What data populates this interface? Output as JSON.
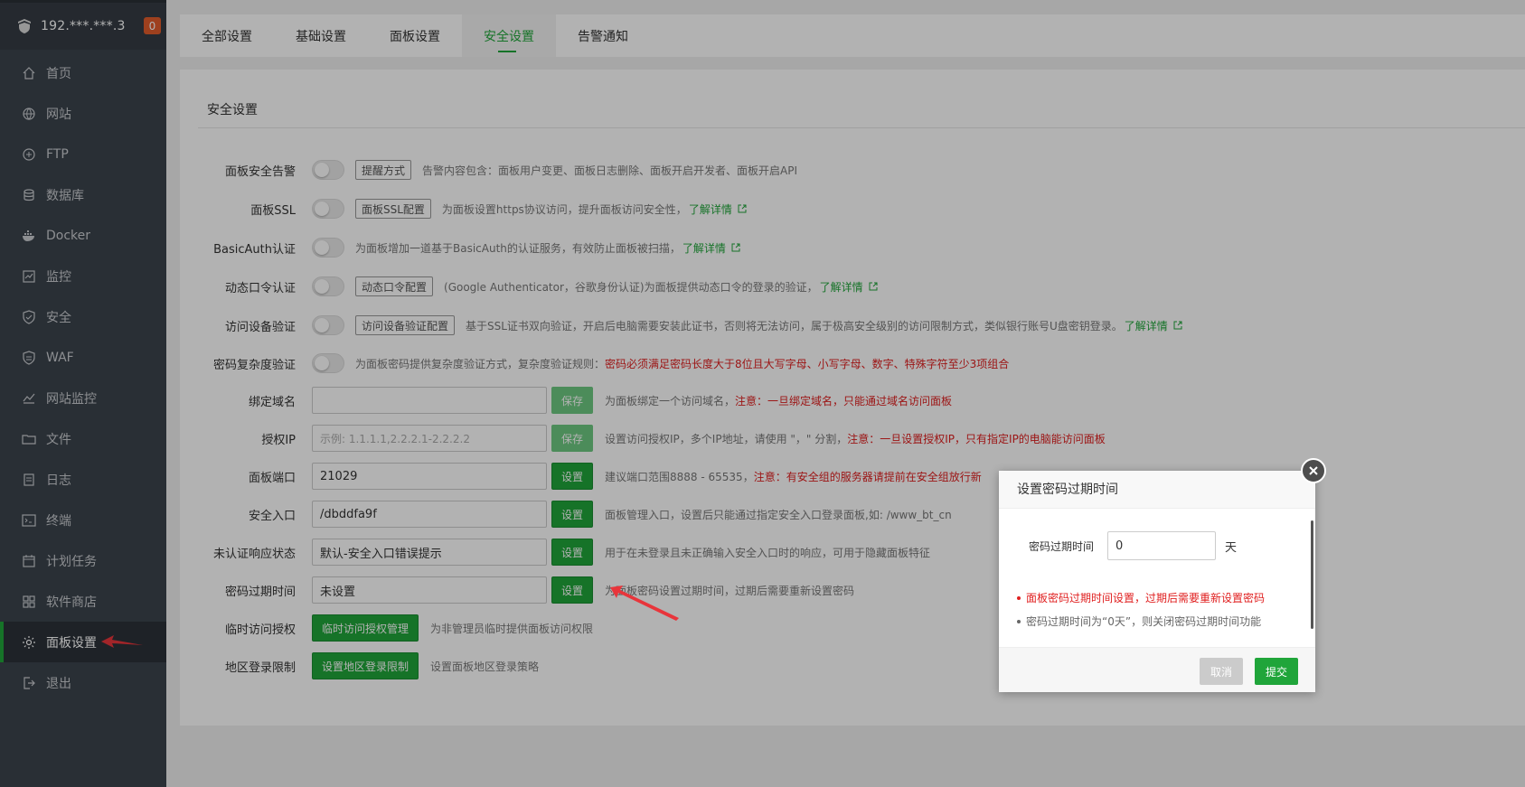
{
  "sidebar": {
    "server_ip": "192.***.***.3",
    "badge_count": "0",
    "items": [
      {
        "label": "首页",
        "icon": "home-icon"
      },
      {
        "label": "网站",
        "icon": "globe-icon"
      },
      {
        "label": "FTP",
        "icon": "ftp-icon"
      },
      {
        "label": "数据库",
        "icon": "database-icon"
      },
      {
        "label": "Docker",
        "icon": "docker-icon"
      },
      {
        "label": "监控",
        "icon": "monitor-icon"
      },
      {
        "label": "安全",
        "icon": "shield-icon"
      },
      {
        "label": "WAF",
        "icon": "waf-icon"
      },
      {
        "label": "网站监控",
        "icon": "chart-icon"
      },
      {
        "label": "文件",
        "icon": "folder-icon"
      },
      {
        "label": "日志",
        "icon": "log-icon"
      },
      {
        "label": "终端",
        "icon": "terminal-icon"
      },
      {
        "label": "计划任务",
        "icon": "calendar-icon"
      },
      {
        "label": "软件商店",
        "icon": "store-icon"
      },
      {
        "label": "面板设置",
        "icon": "gear-icon",
        "active": true
      },
      {
        "label": "退出",
        "icon": "logout-icon"
      }
    ]
  },
  "tabs": [
    "全部设置",
    "基础设置",
    "面板设置",
    "安全设置",
    "告警通知"
  ],
  "active_tab": "安全设置",
  "panel": {
    "title": "安全设置",
    "rows": {
      "alert": {
        "label": "面板安全告警",
        "button": "提醒方式",
        "desc": "告警内容包含：面板用户变更、面板日志删除、面板开启开发者、面板开启API"
      },
      "ssl": {
        "label": "面板SSL",
        "button": "面板SSL配置",
        "desc": "为面板设置https协议访问，提升面板访问安全性，",
        "link": "了解详情"
      },
      "basicauth": {
        "label": "BasicAuth认证",
        "desc": "为面板增加一道基于BasicAuth的认证服务，有效防止面板被扫描，",
        "link": "了解详情"
      },
      "otp": {
        "label": "动态口令认证",
        "button": "动态口令配置",
        "desc": "(Google Authenticator，谷歌身份认证)为面板提供动态口令的登录的验证，",
        "link": "了解详情"
      },
      "device": {
        "label": "访问设备验证",
        "button": "访问设备验证配置",
        "desc": "基于SSL证书双向验证，开启后电脑需要安装此证书，否则将无法访问，属于极高安全级别的访问限制方式，类似银行账号U盘密钥登录。",
        "link": "了解详情"
      },
      "pwcomplex": {
        "label": "密码复杂度验证",
        "desc": "为面板密码提供复杂度验证方式，复杂度验证规则：",
        "warn": "密码必须满足密码长度大于8位且大写字母、小写字母、数字、特殊字符至少3项组合"
      },
      "domain": {
        "label": "绑定域名",
        "value": "",
        "button": "保存",
        "desc": "为面板绑定一个访问域名，",
        "warn": "注意：一旦绑定域名，只能通过域名访问面板"
      },
      "authip": {
        "label": "授权IP",
        "placeholder": "示例: 1.1.1.1,2.2.2.1-2.2.2.2",
        "button": "保存",
        "desc": "设置访问授权IP，多个IP地址，请使用 \"，\" 分割，",
        "warn": "注意：一旦设置授权IP，只有指定IP的电脑能访问面板"
      },
      "port": {
        "label": "面板端口",
        "value": "21029",
        "button": "设置",
        "desc": "建议端口范围8888 - 65535，",
        "warn": "注意：有安全组的服务器请提前在安全组放行新"
      },
      "entry": {
        "label": "安全入口",
        "value": "/dbddfa9f",
        "button": "设置",
        "desc": "面板管理入口，设置后只能通过指定安全入口登录面板,如: /www_bt_cn"
      },
      "unauth": {
        "label": "未认证响应状态",
        "value": "默认-安全入口错误提示",
        "button": "设置",
        "desc": "用于在未登录且未正确输入安全入口时的响应，可用于隐藏面板特征"
      },
      "pwexpire": {
        "label": "密码过期时间",
        "value": "未设置",
        "button": "设置",
        "desc": "为面板密码设置过期时间，过期后需要重新设置密码"
      },
      "tempauth": {
        "label": "临时访问授权",
        "button": "临时访问授权管理",
        "desc": "为非管理员临时提供面板访问权限"
      },
      "region": {
        "label": "地区登录限制",
        "button": "设置地区登录限制",
        "desc": "设置面板地区登录策略"
      }
    }
  },
  "dialog": {
    "title": "设置密码过期时间",
    "field_label": "密码过期时间",
    "field_value": "0",
    "unit": "天",
    "tip_warn": "面板密码过期时间设置，过期后需要重新设置密码",
    "tip_info": "密码过期时间为“0天”，则关闭密码过期时间功能",
    "cancel": "取消",
    "submit": "提交"
  },
  "colors": {
    "accent": "#20a53a",
    "sidebar": "#3c444d",
    "warn": "#e02020"
  }
}
